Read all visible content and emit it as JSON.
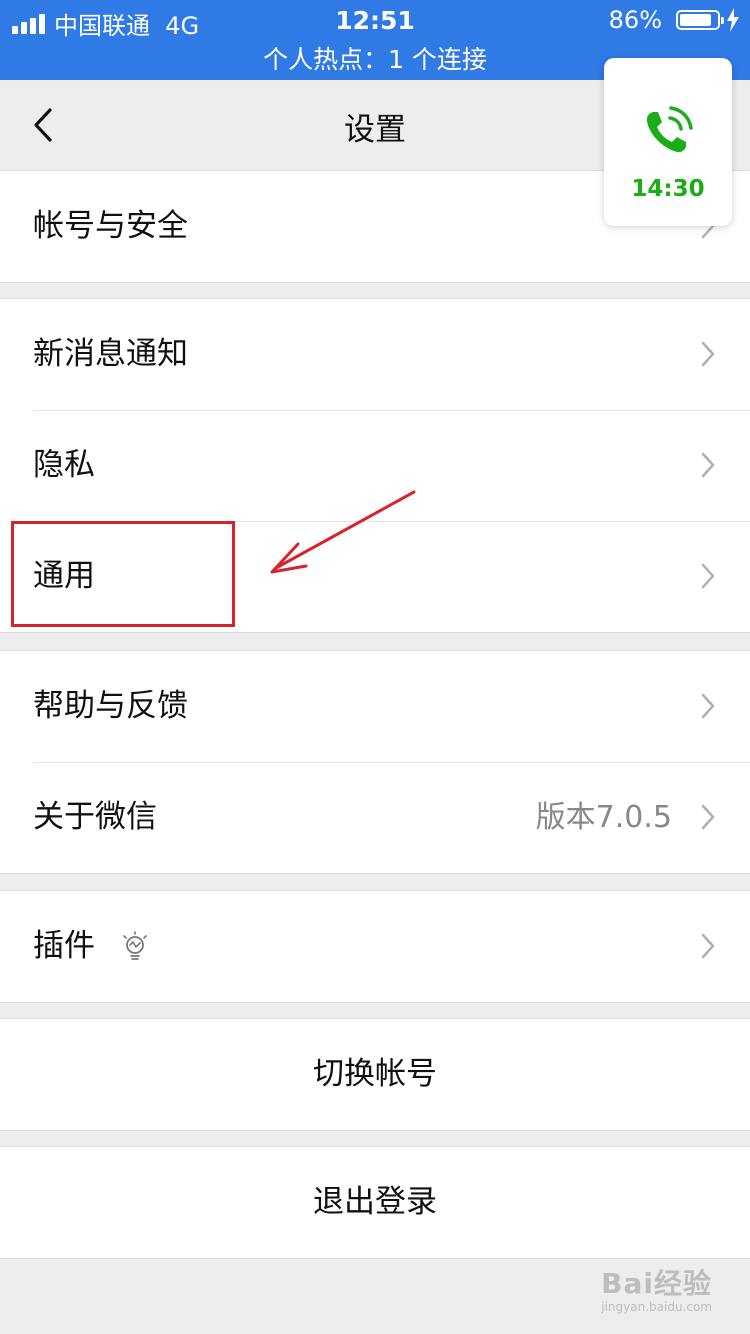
{
  "status_bar": {
    "carrier": "中国联通",
    "network": "4G",
    "time": "12:51",
    "battery_percent": "86%",
    "battery_level": 0.86,
    "hotspot": "个人热点：1 个连接"
  },
  "nav": {
    "title": "设置"
  },
  "call": {
    "duration": "14:30"
  },
  "groups": [
    {
      "items": [
        {
          "label": "帐号与安全"
        }
      ]
    },
    {
      "items": [
        {
          "label": "新消息通知"
        },
        {
          "label": "隐私"
        },
        {
          "label": "通用"
        }
      ]
    },
    {
      "items": [
        {
          "label": "帮助与反馈"
        },
        {
          "label": "关于微信",
          "detail": "版本7.0.5"
        }
      ]
    },
    {
      "items": [
        {
          "label": "插件",
          "icon": "lightbulb-icon"
        }
      ]
    },
    {
      "items": [
        {
          "label": "切换帐号"
        }
      ]
    },
    {
      "items": [
        {
          "label": "退出登录"
        }
      ]
    }
  ],
  "watermark": {
    "main": "Bai经验",
    "sub": "jingyan.baidu.com"
  },
  "colors": {
    "status_bar": "#2f7ae5",
    "call_green": "#1aad19",
    "annotation_red": "#d8232a",
    "background": "#ededed"
  }
}
